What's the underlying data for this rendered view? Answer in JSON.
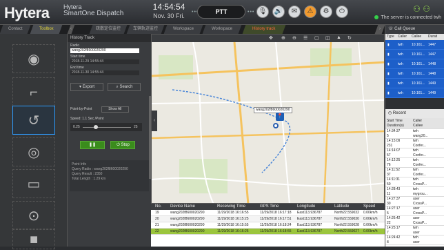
{
  "header": {
    "logo": "Hytera",
    "product_line1": "Hytera",
    "product_line2": "SmartOne Dispatch",
    "time": "14:54:54",
    "date": "Nov. 30 Fri.",
    "ptt_label": "PTT",
    "status_text": "The server is connected",
    "operator": "twh"
  },
  "tabs": {
    "contact": "Contact",
    "toolbox": "Toolbox",
    "t3": "疏散定位监控",
    "t4": "车辆轨迹监控",
    "t5": "Workspace",
    "t6": "Workspace",
    "history": "History track"
  },
  "history_panel": {
    "title": "History Track",
    "radio_label": "Radio",
    "radio_value": "wang202f8600020290",
    "start_label": "Start time",
    "start_value": "2018-11-29 14:55:44",
    "end_label": "End time",
    "end_value": "2018-11-30 14:55:44",
    "export": "Export",
    "search": "Search",
    "p2p_label": "Point-by-Point",
    "show_all": "Show All",
    "speed_label": "Speed: 1.1 Sec./Point",
    "speed_min": "0.25",
    "speed_max": "25",
    "pause": "❚❚",
    "stop": "Stop",
    "info_title": "Point Info",
    "info_query": "Query Radio : wang202f8600020290",
    "info_result": "Query Result : 2350",
    "info_length": "Total Length : 1.29 km"
  },
  "map": {
    "popup": "wang202f8600020290"
  },
  "table": {
    "headers": [
      "No.",
      "Device Name",
      "Receiving Time",
      "GPS Time",
      "Longitude",
      "Latitude",
      "Speed"
    ],
    "rows": [
      [
        "19",
        "wang202f8600020290",
        "11/29/2018 16:16:55",
        "11/29/2018 16:17:18",
        "East113.936787",
        "North22.559032",
        "0.00km/h"
      ],
      [
        "20",
        "wang202f8600020290",
        "11/29/2018 16:15:25",
        "11/29/2018 16:17:51",
        "East113.936787",
        "North22.559030",
        "0.00km/h"
      ],
      [
        "21",
        "wang202f8600020290",
        "11/29/2018 16:15:55",
        "11/29/2018 16:18:24",
        "East113.936787",
        "North22.559028",
        "0.00km/h"
      ],
      [
        "22",
        "wang202f8600020290",
        "11/29/2018 16:16:25",
        "11/29/2018 16:18:55",
        "East113.936787",
        "North22.559027",
        "0.00km/h"
      ]
    ]
  },
  "call_queue": {
    "title": "Call Queue",
    "headers": [
      "Type",
      "Caller",
      "Callee",
      "Durati"
    ],
    "rows": [
      [
        "twh",
        "10.161...",
        "1447"
      ],
      [
        "twh",
        "10.161...",
        "1447"
      ],
      [
        "twh",
        "10.161...",
        "1448"
      ],
      [
        "twh",
        "10.161...",
        "1448"
      ],
      [
        "twh",
        "10.161...",
        "1449"
      ],
      [
        "twh",
        "10.161...",
        "1449"
      ]
    ]
  },
  "recent": {
    "title": "Recent",
    "headers": [
      "Start Time",
      "Caller",
      "Duration(s)",
      "Callee"
    ],
    "rows": [
      [
        "14:34:37",
        "twh",
        "5",
        "wang20..."
      ],
      [
        "14:15:09",
        "twh",
        "231",
        "Confer..."
      ],
      [
        "14:14:07",
        "twh",
        "57",
        "Confer..."
      ],
      [
        "14:12:25",
        "twh",
        "76",
        "Confer..."
      ],
      [
        "14:11:52",
        "twh",
        "37",
        "Confer..."
      ],
      [
        "14:11:31",
        "twh",
        "50",
        "CrossP..."
      ],
      [
        "14:28:43",
        "twh",
        "11",
        "mygrou..."
      ],
      [
        "14:27:37",
        "user",
        "30",
        "CrossP..."
      ],
      [
        "14:27:17",
        "user",
        "5",
        "CrossP..."
      ],
      [
        "14:26:42",
        "user",
        "22",
        "CrossP..."
      ],
      [
        "14:25:17",
        "twh",
        "7",
        "user"
      ],
      [
        "14:24:42",
        "twh",
        "8",
        "user"
      ]
    ]
  }
}
